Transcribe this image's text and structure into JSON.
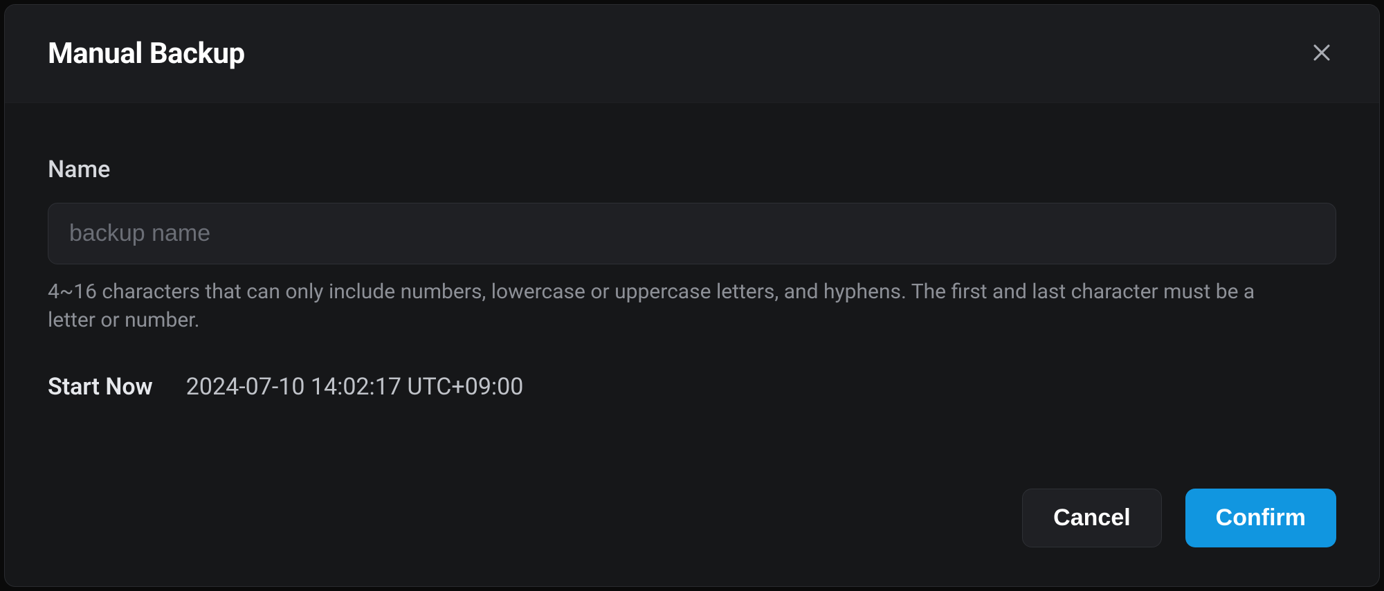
{
  "dialog": {
    "title": "Manual Backup"
  },
  "form": {
    "name_label": "Name",
    "name_placeholder": "backup name",
    "name_value": "",
    "name_helper": "4~16 characters that can only include numbers, lowercase or uppercase letters, and hyphens. The first and last character must be a letter or number.",
    "start_label": "Start Now",
    "start_value": "2024-07-10 14:02:17 UTC+09:00"
  },
  "buttons": {
    "cancel": "Cancel",
    "confirm": "Confirm"
  }
}
